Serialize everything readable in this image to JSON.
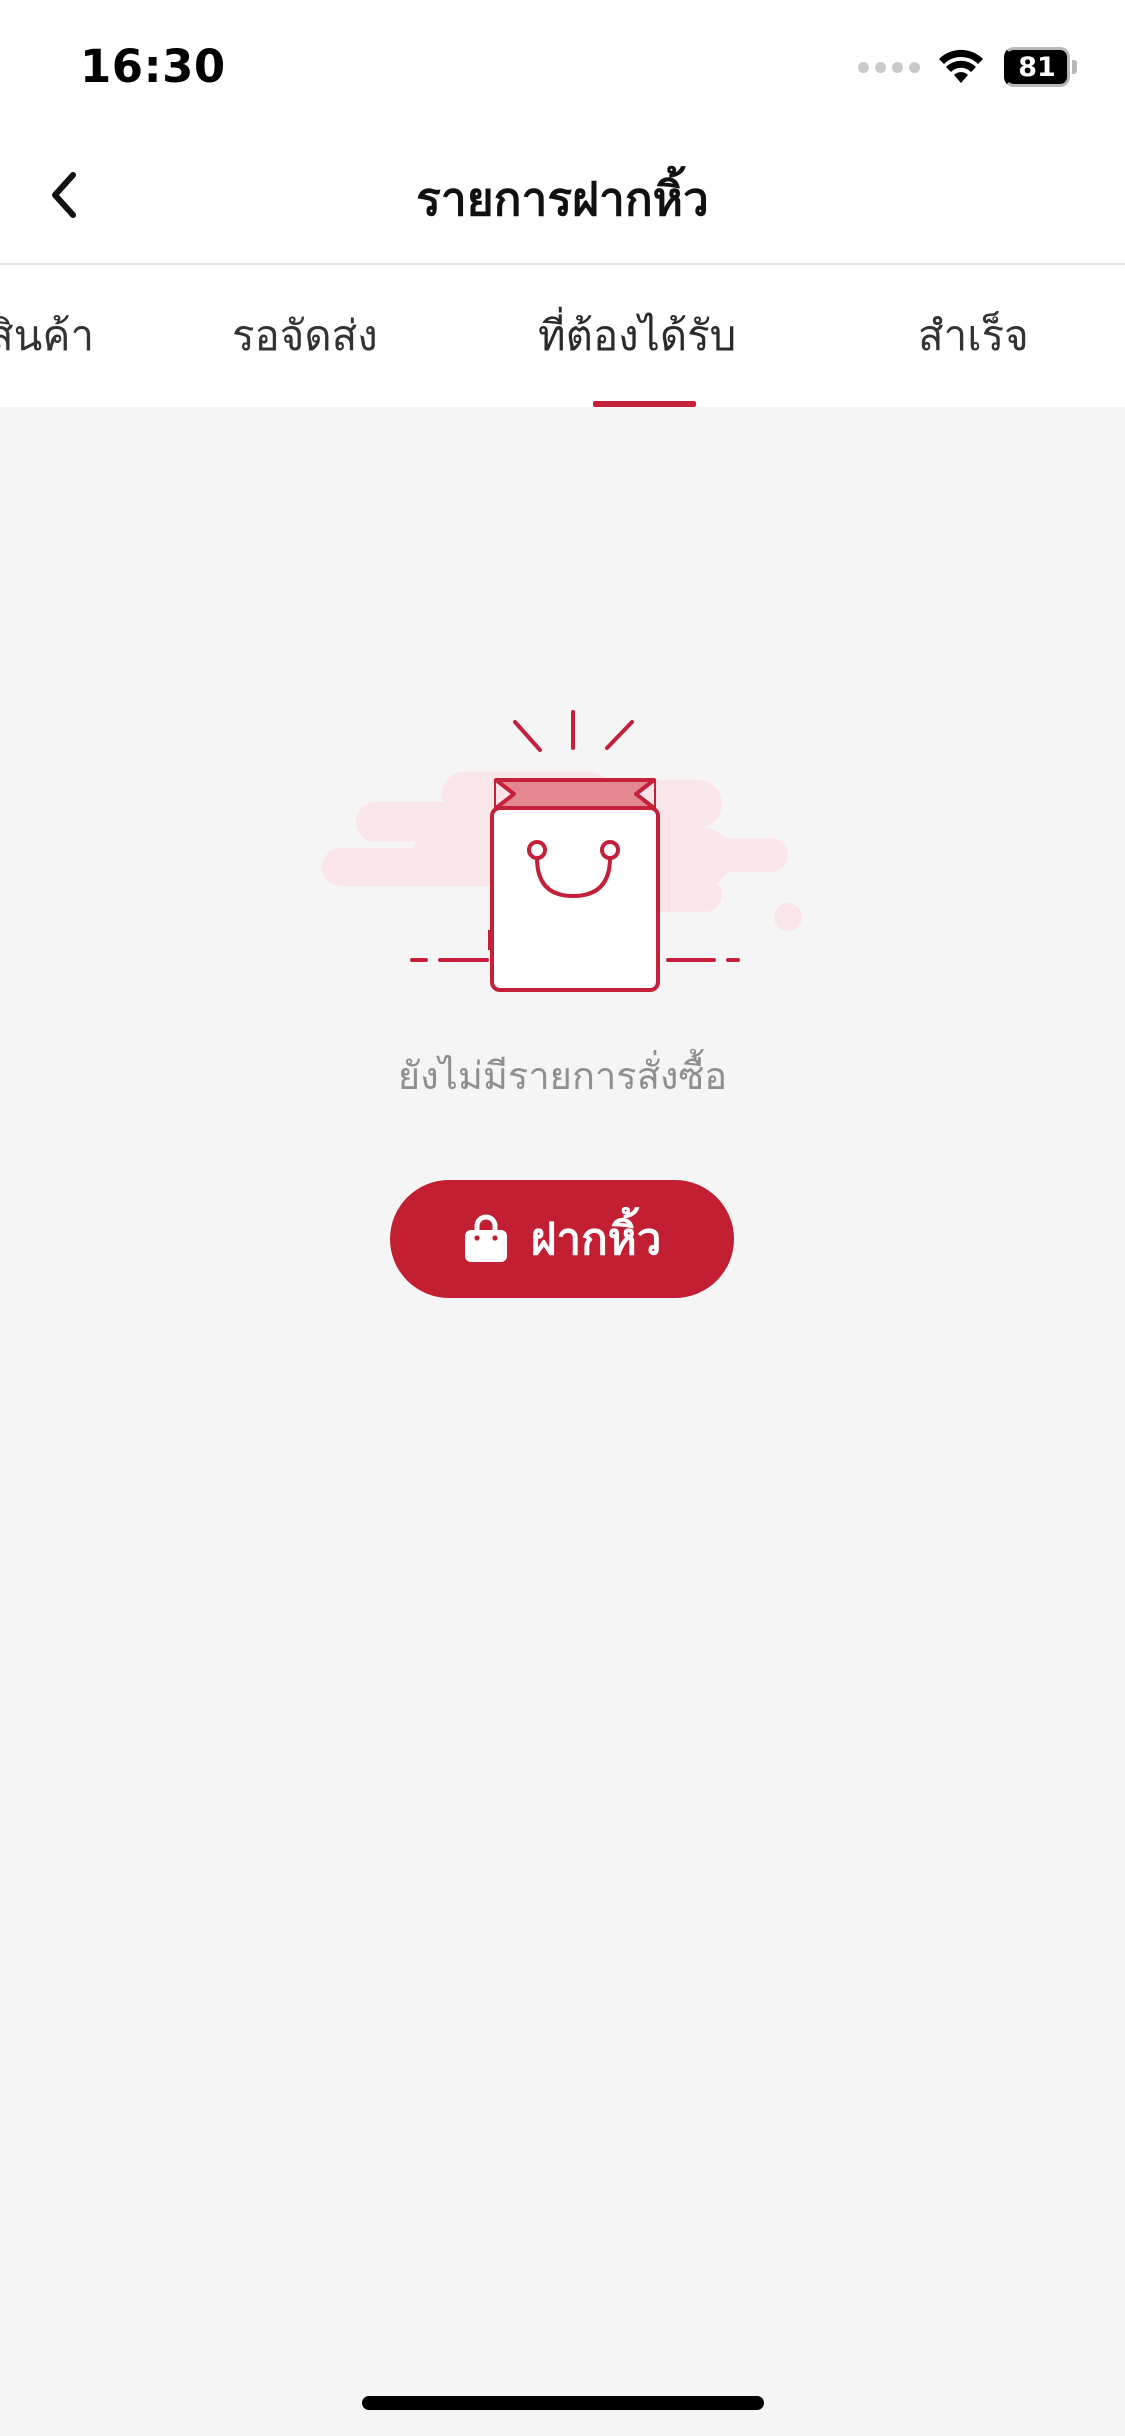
{
  "status_bar": {
    "time": "16:30",
    "battery": "81",
    "icons": [
      "signal-dots-icon",
      "wifi-icon",
      "battery-icon"
    ]
  },
  "nav": {
    "title": "รายการฝากหิ้ว",
    "back_icon": "chevron-left-icon"
  },
  "tabs": [
    {
      "label": "สินค้า",
      "active": false
    },
    {
      "label": "รอจัดส่ง",
      "active": false
    },
    {
      "label": "ที่ต้องได้รับ",
      "active": true
    },
    {
      "label": "สำเร็จ",
      "active": false
    }
  ],
  "empty_state": {
    "illustration": "shopping-bag-illustration",
    "message": "ยังไม่มีรายการสั่งซื้อ"
  },
  "action_button": {
    "label": "ฝากหิ้ว",
    "icon": "bag-icon"
  },
  "colors": {
    "accent": "#c21f33",
    "background": "#f5f5f5",
    "surface": "#ffffff",
    "muted_text": "#8f8f8f"
  }
}
